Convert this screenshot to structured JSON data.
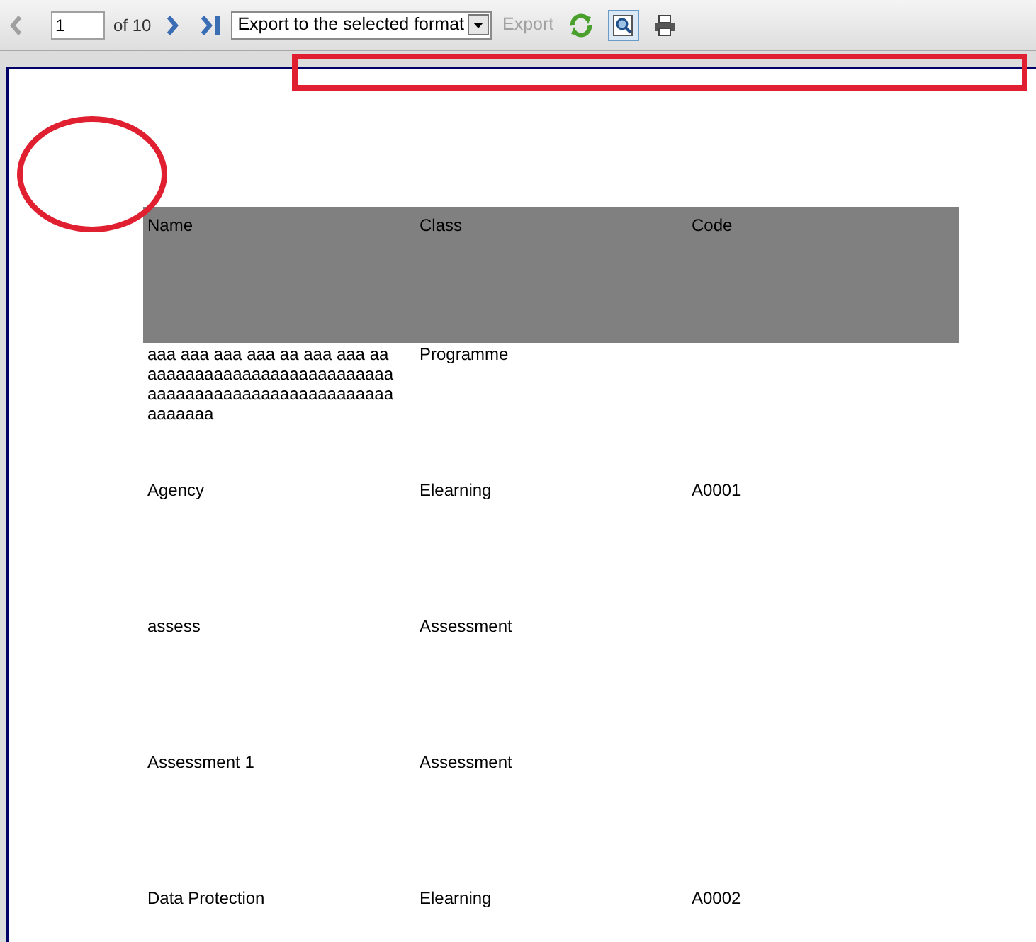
{
  "toolbar": {
    "page_value": "1",
    "page_count": "of 10",
    "export_format": "Export to the selected format",
    "export_button": "Export",
    "export_disabled": true
  },
  "table": {
    "columns": [
      "Name",
      "Class",
      "Code"
    ],
    "rows": [
      {
        "cells": [
          [
            "aaa aaa aaa aaa aa aaa aaa aa",
            "aaaaaaaaaaaaaaaaaaaaaaaaaa",
            "aaaaaaaaaaaaaaaaaaaaaaaaaa",
            "aaaaaaa"
          ],
          [
            "Programme"
          ],
          []
        ]
      },
      {
        "cells": [
          [
            "Agency"
          ],
          [
            "Elearning"
          ],
          [
            "A0001"
          ]
        ]
      },
      {
        "cells": [
          [
            "assess"
          ],
          [
            "Assessment"
          ],
          []
        ]
      },
      {
        "cells": [
          [
            "Assessment 1"
          ],
          [
            "Assessment"
          ],
          []
        ]
      },
      {
        "cells": [
          [
            "Data Protection"
          ],
          [
            "Elearning"
          ],
          [
            "A0002"
          ]
        ]
      }
    ]
  }
}
